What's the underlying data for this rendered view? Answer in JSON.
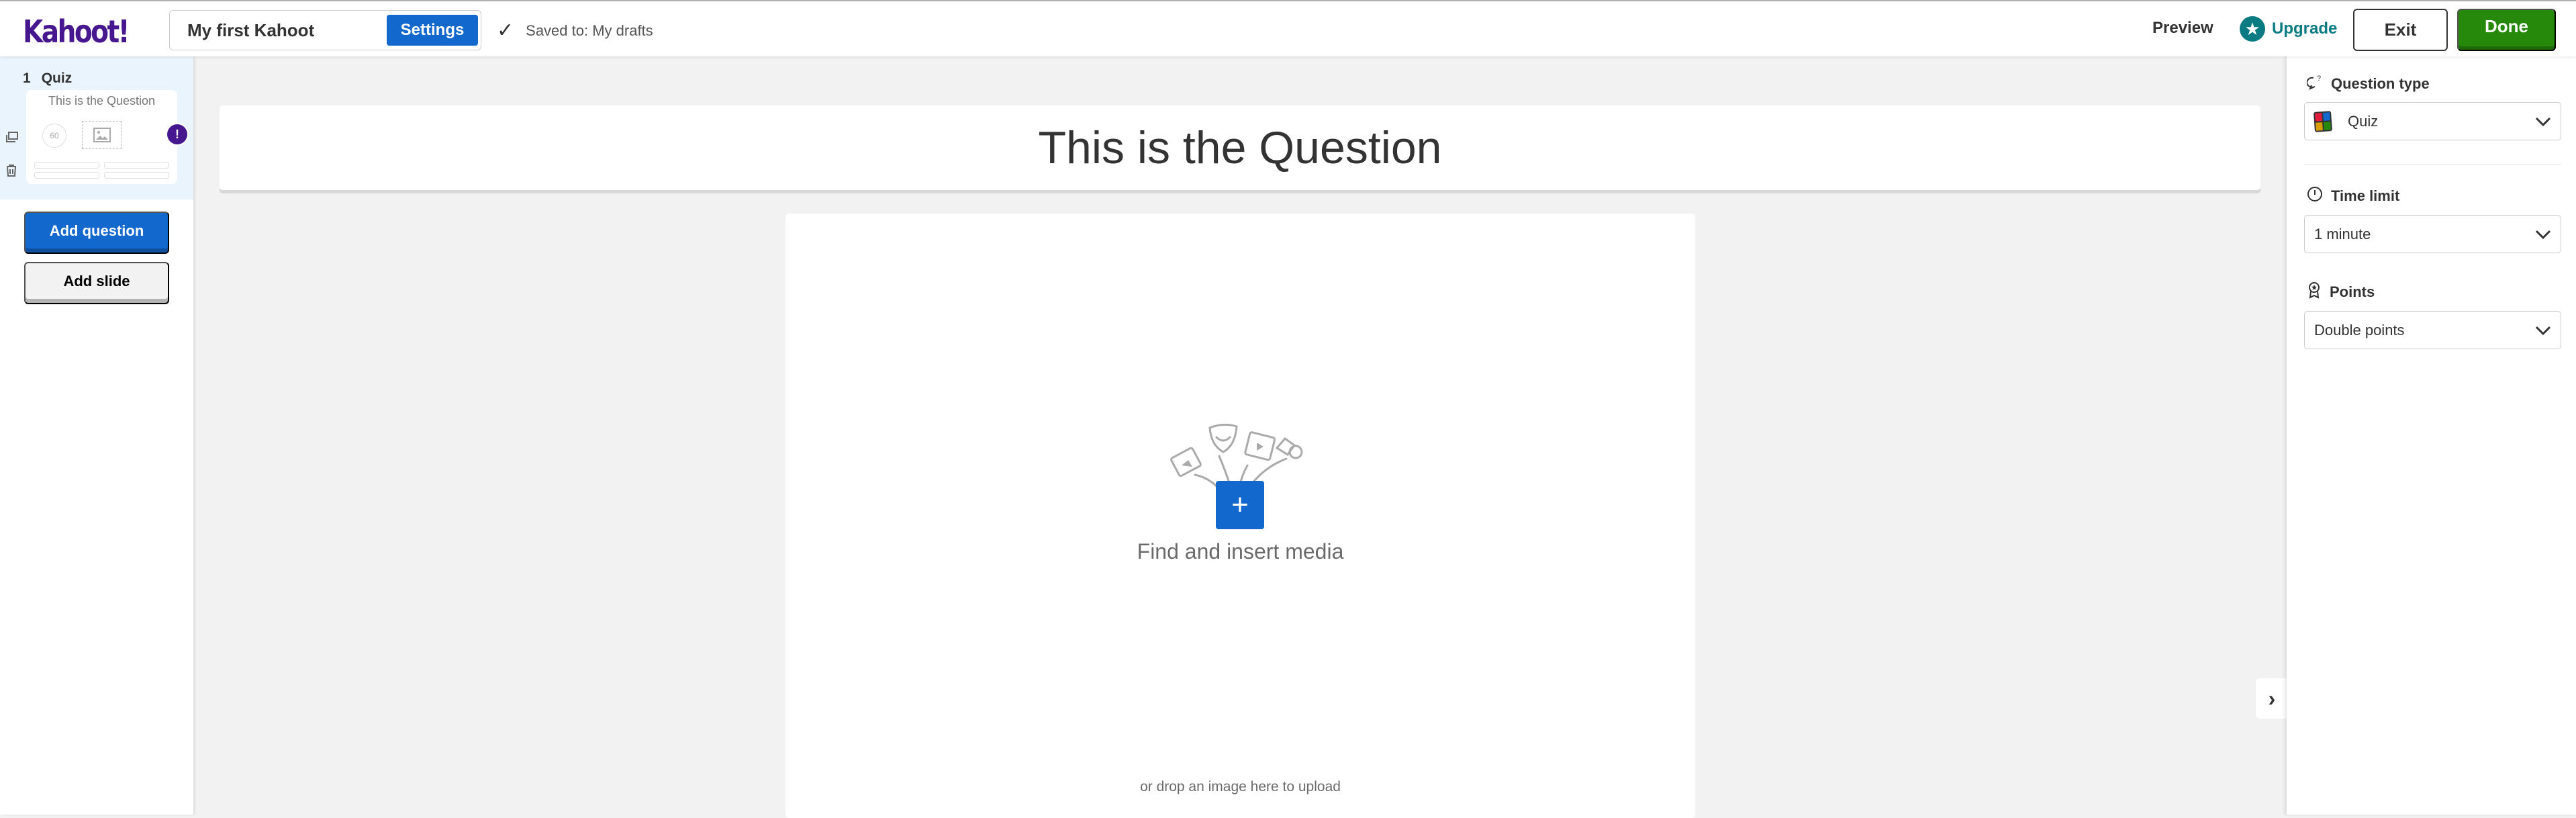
{
  "topbar": {
    "logo": "Kahoot!",
    "kahoot_title": "My first Kahoot",
    "settings_label": "Settings",
    "saved_status": "Saved to: My drafts",
    "preview_label": "Preview",
    "upgrade_label": "Upgrade",
    "exit_label": "Exit",
    "done_label": "Done"
  },
  "sidebar": {
    "slides": [
      {
        "number": "1",
        "type": "Quiz",
        "question": "This is the Question",
        "timer": "60",
        "warning": "!"
      }
    ],
    "add_question_label": "Add question",
    "add_slide_label": "Add slide"
  },
  "editor": {
    "question_title": "This is the Question",
    "media_prompt": "Find and insert media",
    "drop_hint": "or drop an image here to upload"
  },
  "settings_panel": {
    "question_type": {
      "label": "Question type",
      "value": "Quiz"
    },
    "time_limit": {
      "label": "Time limit",
      "value": "1 minute"
    },
    "points": {
      "label": "Points",
      "value": "Double points"
    }
  },
  "colors": {
    "brand": "#46178f",
    "primary": "#1368ce",
    "done": "#26890c",
    "upgrade": "#0a7b83"
  }
}
